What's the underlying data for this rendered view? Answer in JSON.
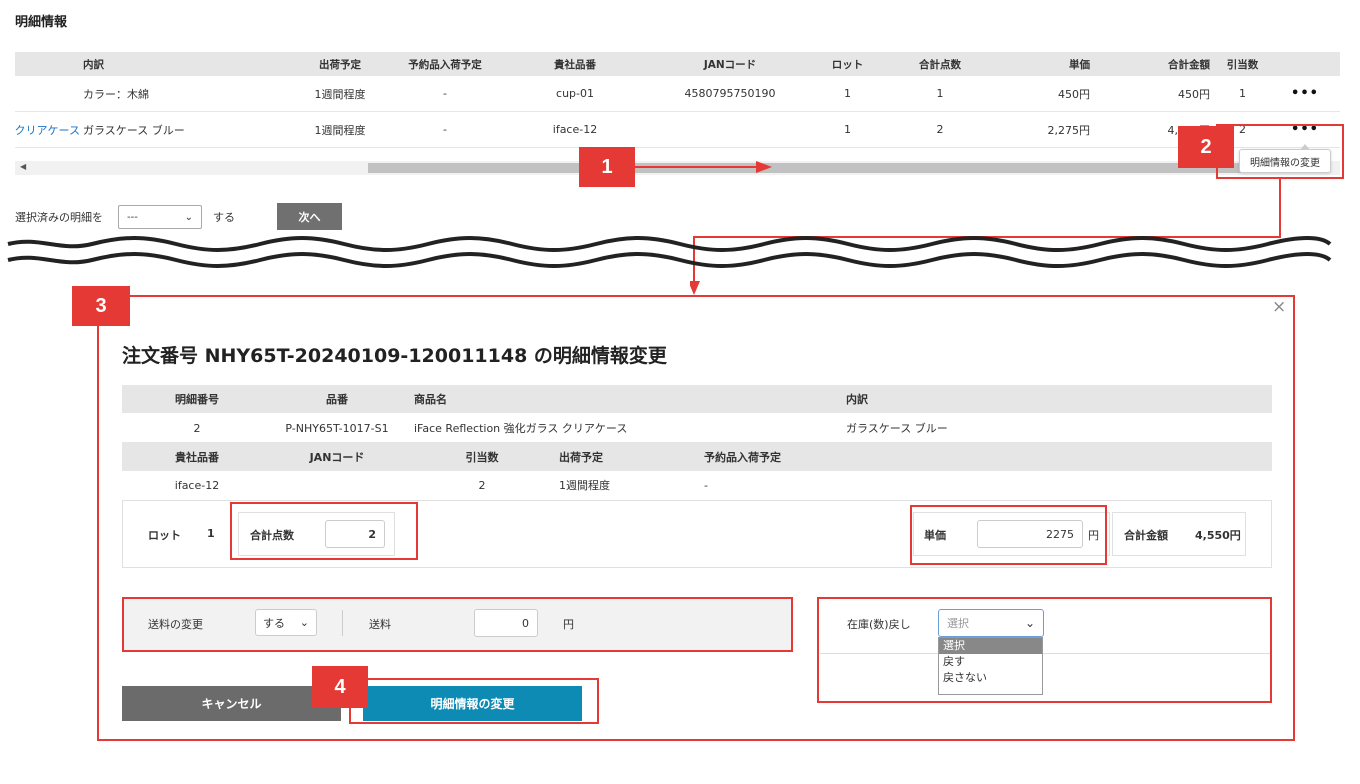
{
  "section_title": "明細情報",
  "table": {
    "headers": [
      "内訳",
      "出荷予定",
      "予約品入荷予定",
      "貴社品番",
      "JANコード",
      "ロット",
      "合計点数",
      "単価",
      "合計金額",
      "引当数"
    ],
    "rows": [
      {
        "prefix": "",
        "detail": "カラー：木綿",
        "ship": "1週間程度",
        "reserve": "-",
        "sku": "cup-01",
        "jan": "4580795750190",
        "lot": "1",
        "qty": "1",
        "price": "450円",
        "total": "450円",
        "alloc": "1",
        "menu": "•••"
      },
      {
        "prefix": "クリアケース",
        "detail": "ガラスケース ブルー",
        "ship": "1週間程度",
        "reserve": "-",
        "sku": "iface-12",
        "jan": "",
        "lot": "1",
        "qty": "2",
        "price": "2,275円",
        "total": "4,550円",
        "alloc": "2",
        "menu": "•••"
      }
    ]
  },
  "tooltip": "明細情報の変更",
  "bulk": {
    "label": "選択済みの明細を",
    "select_value": "---",
    "suffix": "する",
    "next_button": "次へ"
  },
  "badges": [
    "1",
    "2",
    "3",
    "4"
  ],
  "colors": {
    "accent_red": "#e53935",
    "submit_blue": "#0e8bb5",
    "cancel_gray": "#6b6b6b"
  },
  "modal": {
    "close": "×",
    "title": "注文番号 NHY65T-20240109-120011148 の明細情報変更",
    "info_headers_1": [
      "明細番号",
      "品番",
      "商品名",
      "内訳"
    ],
    "info_values_1": [
      "2",
      "P-NHY65T-1017-S1",
      "iFace Reflection 強化ガラス クリアケース",
      "ガラスケース ブルー"
    ],
    "info_headers_2": [
      "貴社品番",
      "JANコード",
      "引当数",
      "出荷予定",
      "予約品入荷予定"
    ],
    "info_values_2": [
      "iface-12",
      "",
      "2",
      "1週間程度",
      "-"
    ],
    "lot_label": "ロット",
    "lot_value": "1",
    "qty_label": "合計点数",
    "qty_value": "2",
    "price_label": "単価",
    "price_value": "2275",
    "price_unit": "円",
    "total_label": "合計金額",
    "total_value": "4,550円",
    "shipping_change_label": "送料の変更",
    "shipping_change_value": "する",
    "shipping_label": "送料",
    "shipping_value": "0",
    "shipping_unit": "円",
    "stock_label": "在庫(数)戻し",
    "stock_select_placeholder": "選択",
    "stock_options": [
      "選択",
      "戻す",
      "戻さない"
    ],
    "cancel_button": "キャンセル",
    "submit_button": "明細情報の変更"
  }
}
